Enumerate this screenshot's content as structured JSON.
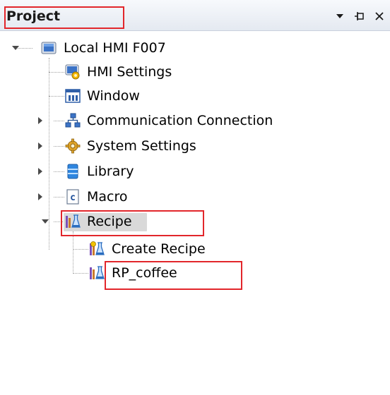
{
  "panel": {
    "title": "Project",
    "buttons": [
      "dropdown-icon",
      "pin-icon",
      "close-icon"
    ]
  },
  "tree": {
    "root": {
      "label": "Local HMI F007",
      "icon": "monitor-icon",
      "expanded": true
    },
    "children": [
      {
        "label": "HMI Settings",
        "icon": "hmi-settings-icon",
        "expandable": false
      },
      {
        "label": "Window",
        "icon": "window-icon",
        "expandable": false
      },
      {
        "label": "Communication Connection",
        "icon": "network-icon",
        "expandable": true,
        "expanded": false
      },
      {
        "label": "System Settings",
        "icon": "gear-icon",
        "expandable": true,
        "expanded": false
      },
      {
        "label": "Library",
        "icon": "library-icon",
        "expandable": true,
        "expanded": false
      },
      {
        "label": "Macro",
        "icon": "macro-icon",
        "expandable": true,
        "expanded": false
      },
      {
        "label": "Recipe",
        "icon": "recipe-icon",
        "expandable": true,
        "expanded": true,
        "selected": true
      }
    ],
    "recipe_children": [
      {
        "label": "Create Recipe",
        "icon": "create-recipe-icon"
      },
      {
        "label": "RP_coffee",
        "icon": "recipe-item-icon"
      }
    ]
  },
  "colors": {
    "highlight": "#e2262b",
    "selection": "#d9d9d9",
    "header_bg": "#e4e9f1"
  }
}
